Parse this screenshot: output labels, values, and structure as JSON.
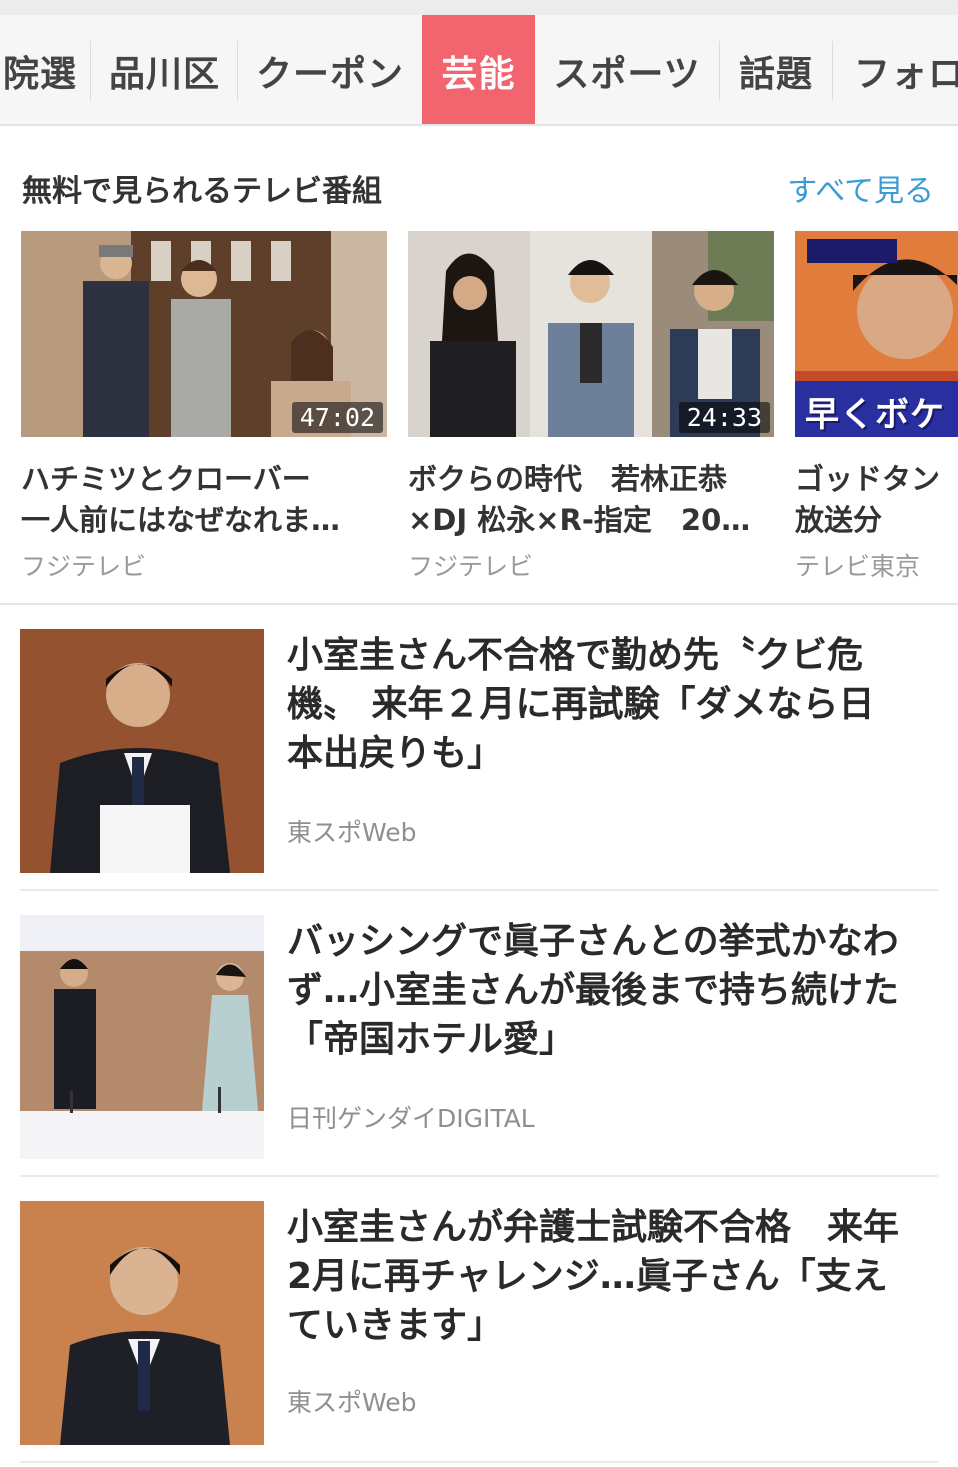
{
  "tabs": [
    {
      "label": "院選",
      "active": false
    },
    {
      "label": "品川区",
      "active": false
    },
    {
      "label": "クーポン",
      "active": false
    },
    {
      "label": "芸能",
      "active": true
    },
    {
      "label": "スポーツ",
      "active": false
    },
    {
      "label": "話題",
      "active": false
    },
    {
      "label": "フォロ",
      "active": false
    }
  ],
  "tv_section": {
    "title": "無料で見られるテレビ番組",
    "see_all": "すべて見る",
    "cards": [
      {
        "duration": "47:02",
        "title_line1": "ハチミツとクローバー",
        "title_line2": "一人前にはなぜなれま…",
        "source": "フジテレビ"
      },
      {
        "duration": "24:33",
        "title_line1": "ボクらの時代　若林正恭",
        "title_line2": "×DJ 松永×R-指定　20…",
        "source": "フジテレビ"
      },
      {
        "duration": "",
        "thumb_caption": "早くボケ",
        "title_line1": "ゴッドタン",
        "title_line2": "放送分",
        "source": "テレビ東京"
      }
    ]
  },
  "news": [
    {
      "title_lines": [
        "小室圭さん不合格で勤め先〝クビ危",
        "機〟 来年２月に再試験「ダメなら日",
        "本出戻りも」"
      ],
      "source": "東スポWeb"
    },
    {
      "title_lines": [
        "バッシングで眞子さんとの挙式かなわ",
        "ず…小室圭さんが最後まで持ち続けた",
        "「帝国ホテル愛」"
      ],
      "source": "日刊ゲンダイDIGITAL"
    },
    {
      "title_lines": [
        "小室圭さんが弁護士試験不合格　来年",
        "2月に再チャレンジ…眞子さん「支え",
        "ていきます」"
      ],
      "source": "東スポWeb"
    }
  ],
  "colors": {
    "accent_tab": "#f2656f",
    "link": "#3a9bd5"
  }
}
